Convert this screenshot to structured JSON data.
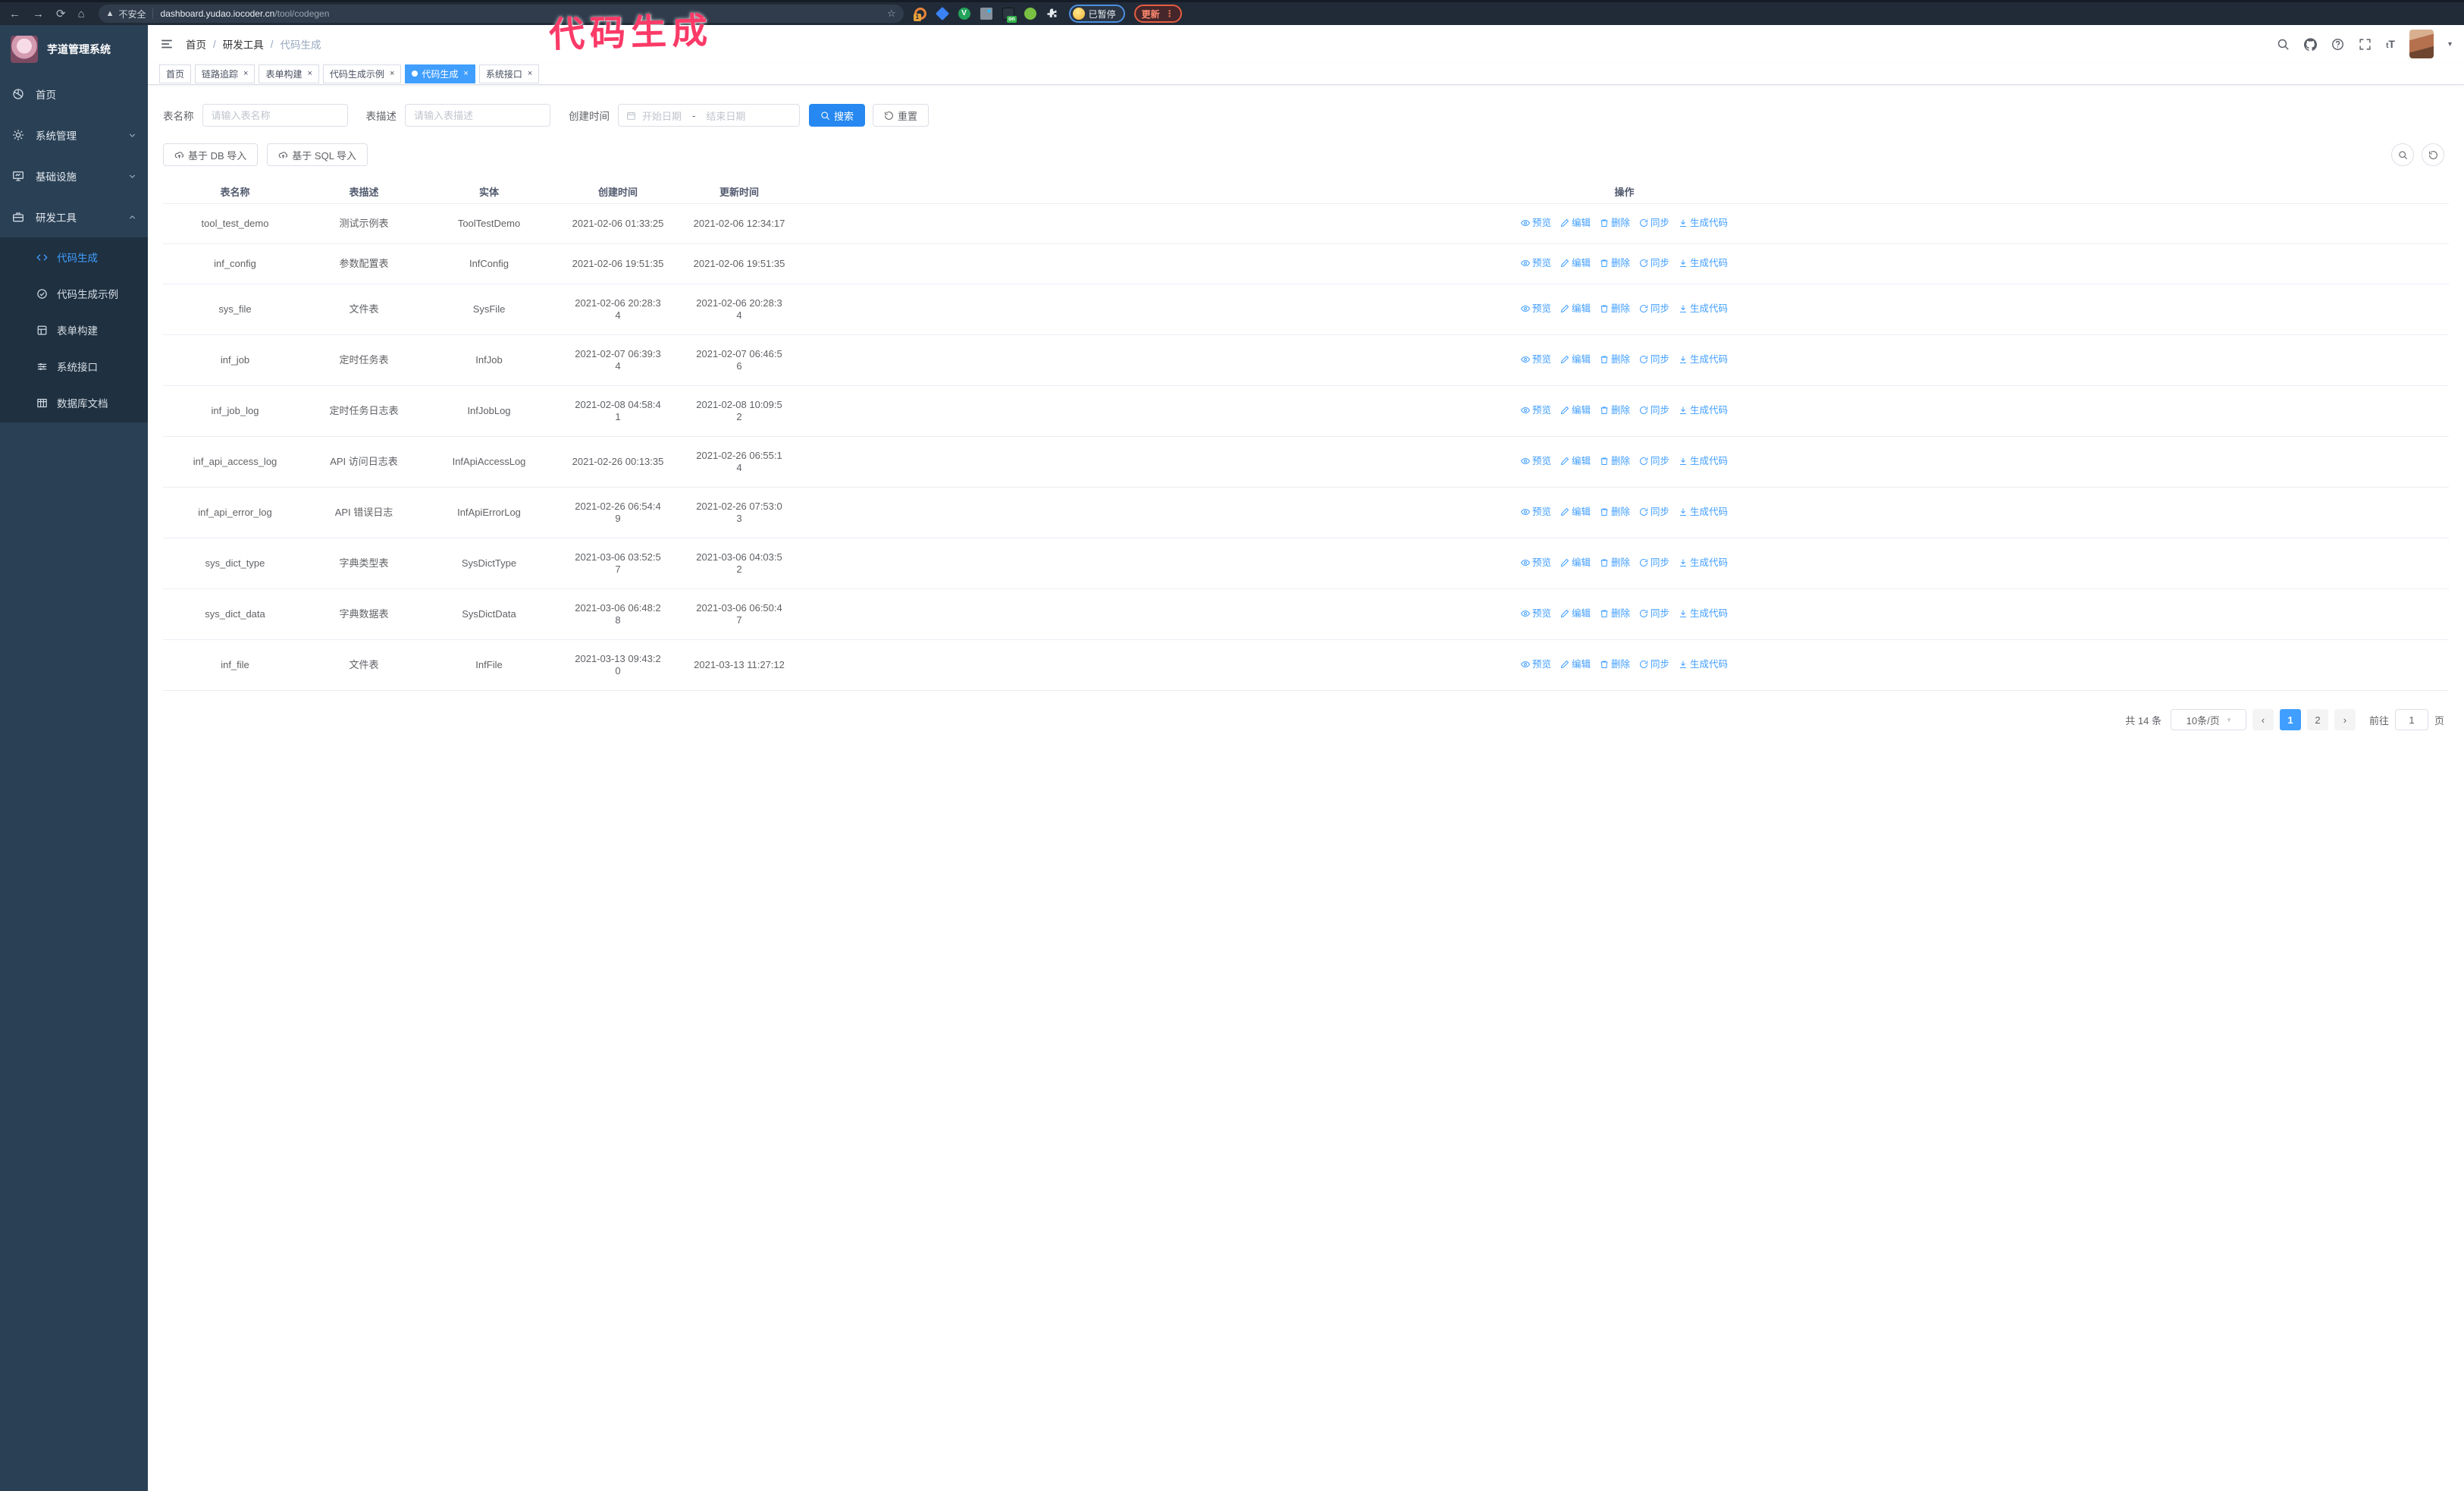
{
  "colors": {
    "primary": "#409EFF",
    "sidebar_bg": "#2a4055",
    "submenu_bg": "#1f3040",
    "annotation_pink": "#fb3a67",
    "chrome_bg": "#212b37"
  },
  "annotation": {
    "text": "代码生成"
  },
  "browser": {
    "security_label": "不安全",
    "url_host": "dashboard.yudao.iocoder.cn",
    "url_path": "/tool/codegen",
    "extension_badge": "1",
    "extension_on_badge": "on",
    "extension_check": "V",
    "paused_badge": "已暂停",
    "update_button": "更新"
  },
  "sidebar": {
    "title": "芋道管理系统",
    "items": [
      {
        "label": "首页"
      },
      {
        "label": "系统管理"
      },
      {
        "label": "基础设施"
      },
      {
        "label": "研发工具"
      }
    ],
    "subitems": [
      {
        "label": "代码生成"
      },
      {
        "label": "代码生成示例"
      },
      {
        "label": "表单构建"
      },
      {
        "label": "系统接口"
      },
      {
        "label": "数据库文档"
      }
    ]
  },
  "navbar": {
    "breadcrumb": [
      "首页",
      "研发工具",
      "代码生成"
    ]
  },
  "tabs": [
    {
      "label": "首页"
    },
    {
      "label": "链路追踪"
    },
    {
      "label": "表单构建"
    },
    {
      "label": "代码生成示例"
    },
    {
      "label": "代码生成"
    },
    {
      "label": "系统接口"
    }
  ],
  "filters": {
    "name_label": "表名称",
    "name_placeholder": "请输入表名称",
    "desc_label": "表描述",
    "desc_placeholder": "请输入表描述",
    "time_label": "创建时间",
    "start_placeholder": "开始日期",
    "range_separator": "-",
    "end_placeholder": "结束日期",
    "search_label": "搜索",
    "reset_label": "重置"
  },
  "toolbar": {
    "import_db": "基于 DB 导入",
    "import_sql": "基于 SQL 导入"
  },
  "table": {
    "columns": [
      "表名称",
      "表描述",
      "实体",
      "创建时间",
      "更新时间",
      "操作"
    ],
    "actions": [
      "预览",
      "编辑",
      "删除",
      "同步",
      "生成代码"
    ],
    "rows": [
      {
        "name": "tool_test_demo",
        "desc": "测试示例表",
        "entity": "ToolTestDemo",
        "created": "2021-02-06 01:33:25",
        "updated": "2021-02-06 12:34:17"
      },
      {
        "name": "inf_config",
        "desc": "参数配置表",
        "entity": "InfConfig",
        "created": "2021-02-06 19:51:35",
        "updated": "2021-02-06 19:51:35"
      },
      {
        "name": "sys_file",
        "desc": "文件表",
        "entity": "SysFile",
        "created": "2021-02-06 20:28:3\n4",
        "updated": "2021-02-06 20:28:3\n4"
      },
      {
        "name": "inf_job",
        "desc": "定时任务表",
        "entity": "InfJob",
        "created": "2021-02-07 06:39:3\n4",
        "updated": "2021-02-07 06:46:5\n6"
      },
      {
        "name": "inf_job_log",
        "desc": "定时任务日志表",
        "entity": "InfJobLog",
        "created": "2021-02-08 04:58:4\n1",
        "updated": "2021-02-08 10:09:5\n2"
      },
      {
        "name": "inf_api_access_log",
        "desc": "API 访问日志表",
        "entity": "InfApiAccessLog",
        "created": "2021-02-26 00:13:35",
        "updated": "2021-02-26 06:55:1\n4"
      },
      {
        "name": "inf_api_error_log",
        "desc": "API 错误日志",
        "entity": "InfApiErrorLog",
        "created": "2021-02-26 06:54:4\n9",
        "updated": "2021-02-26 07:53:0\n3"
      },
      {
        "name": "sys_dict_type",
        "desc": "字典类型表",
        "entity": "SysDictType",
        "created": "2021-03-06 03:52:5\n7",
        "updated": "2021-03-06 04:03:5\n2"
      },
      {
        "name": "sys_dict_data",
        "desc": "字典数据表",
        "entity": "SysDictData",
        "created": "2021-03-06 06:48:2\n8",
        "updated": "2021-03-06 06:50:4\n7"
      },
      {
        "name": "inf_file",
        "desc": "文件表",
        "entity": "InfFile",
        "created": "2021-03-13 09:43:2\n0",
        "updated": "2021-03-13 11:27:12"
      }
    ]
  },
  "pagination": {
    "total": "共 14 条",
    "page_size": "10条/页",
    "pages": [
      "1",
      "2"
    ],
    "current": "1",
    "goto_label": "前往",
    "goto_value": "1",
    "goto_suffix": "页"
  }
}
